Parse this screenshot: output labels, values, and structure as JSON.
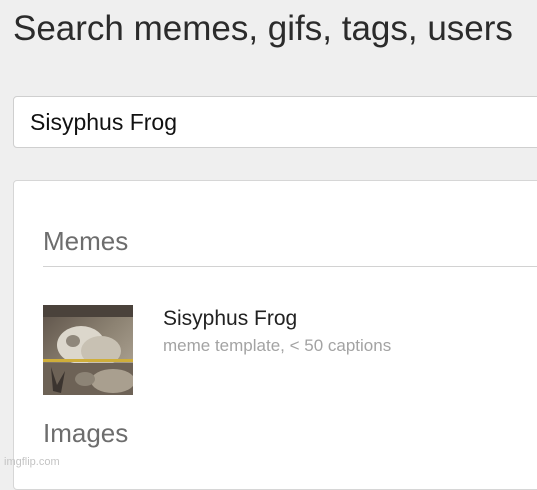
{
  "header": {
    "title": "Search memes, gifs, tags, users"
  },
  "search": {
    "value": "Sisyphus Frog"
  },
  "results": {
    "memes_heading": "Memes",
    "items": [
      {
        "name": "Sisyphus Frog",
        "meta": "meme template, < 50 captions",
        "thumbnail": "frog-meme-thumbnail"
      }
    ],
    "images_heading": "Images"
  },
  "watermark": {
    "text": "imgflip.com"
  },
  "colors": {
    "page_background": "#efefef",
    "card_background": "#ffffff",
    "section_heading": "#6d6d6d",
    "meta_text": "#a3a3a3"
  }
}
